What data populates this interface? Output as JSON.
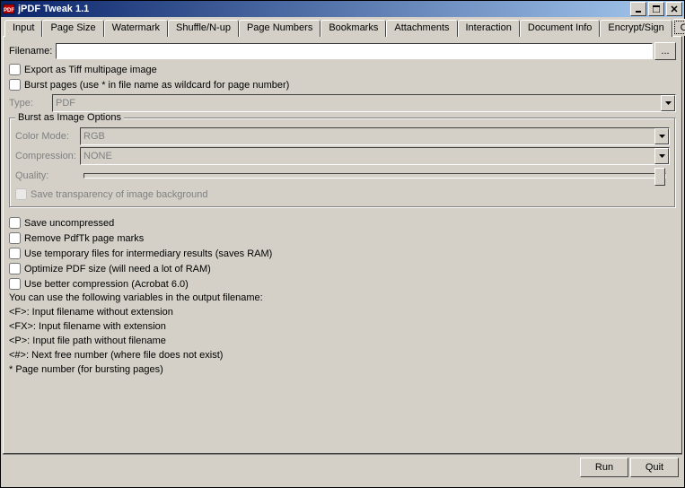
{
  "window": {
    "title": "jPDF Tweak 1.1"
  },
  "tabs": {
    "items": [
      "Input",
      "Page Size",
      "Watermark",
      "Shuffle/N-up",
      "Page Numbers",
      "Bookmarks",
      "Attachments",
      "Interaction",
      "Document Info",
      "Encrypt/Sign",
      "Output"
    ],
    "active_index": 10
  },
  "output": {
    "filename_label": "Filename:",
    "filename_value": "",
    "browse_label": "...",
    "export_tiff_label": "Export as Tiff multipage image",
    "export_tiff_checked": false,
    "burst_label": "Burst pages (use * in file name as wildcard for page number)",
    "burst_checked": false,
    "type_label": "Type:",
    "type_value": "PDF",
    "image_options": {
      "legend": "Burst as Image Options",
      "color_mode_label": "Color Mode:",
      "color_mode_value": "RGB",
      "compression_label": "Compression:",
      "compression_value": "NONE",
      "quality_label": "Quality:",
      "save_transparency_label": "Save transparency of image background",
      "save_transparency_checked": false
    },
    "save_uncompressed_label": "Save uncompressed",
    "save_uncompressed_checked": false,
    "remove_pdftk_label": "Remove PdfTk page marks",
    "remove_pdftk_checked": false,
    "use_temp_label": "Use temporary files for intermediary results (saves RAM)",
    "use_temp_checked": false,
    "optimize_label": "Optimize PDF size (will need a lot of RAM)",
    "optimize_checked": false,
    "better_compression_label": "Use better compression (Acrobat 6.0)",
    "better_compression_checked": false,
    "help_lines": [
      "You can use the following variables in the output filename:",
      "<F>: Input filename without extension",
      "<FX>: Input filename with extension",
      "<P>: Input file path without filename",
      "<#>: Next free number (where file does not exist)",
      "* Page number (for bursting pages)"
    ]
  },
  "buttons": {
    "run": "Run",
    "quit": "Quit"
  }
}
